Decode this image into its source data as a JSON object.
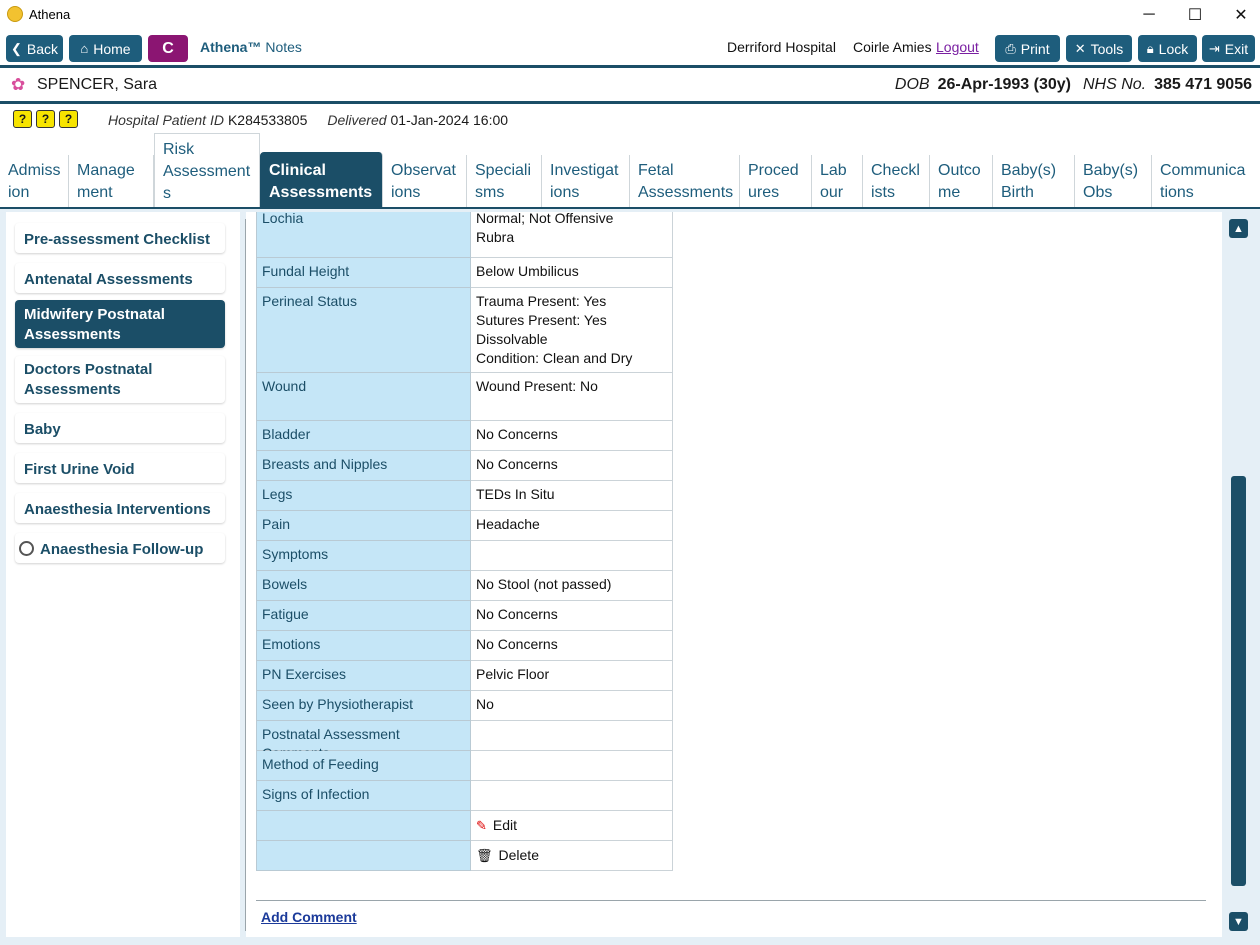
{
  "window": {
    "title": "Athena",
    "minimize": "─",
    "maximize": "☐",
    "close": "✕"
  },
  "toolbar": {
    "back": "Back",
    "home": "Home",
    "c_label": "C",
    "brand_name": "Athena™",
    "brand_sub": "Notes",
    "hospital": "Derriford Hospital",
    "user": "Coirle Amies",
    "logout": "Logout",
    "print": "Print",
    "tools": "Tools",
    "lock": "Lock",
    "exit": "Exit"
  },
  "patient": {
    "name": "SPENCER, Sara",
    "dob_label": "DOB",
    "dob": "26-Apr-1993 (30y)",
    "nhs_label": "NHS No.",
    "nhs": "385 471 9056",
    "hospital_id_label": "Hospital Patient ID",
    "hospital_id": "K284533805",
    "delivered_label": "Delivered",
    "delivered": "01-Jan-2024 16:00",
    "flags": [
      "?",
      "?",
      "?"
    ]
  },
  "tabs": [
    "Admiss ion",
    "Manage ment",
    "Risk Assessment s",
    "Clinical Assessments",
    "Observat ions",
    "Speciali sms",
    "Investigat ions",
    "Fetal Assessments",
    "Proced ures",
    "Lab our",
    "Checkl ists",
    "Outco me",
    "Baby(s) Birth",
    "Baby(s) Obs",
    "Communica tions"
  ],
  "sidebar": [
    "Pre-assessment Checklist",
    "Antenatal Assessments",
    "Midwifery Postnatal Assessments",
    "Doctors Postnatal Assessments",
    "Baby",
    "First Urine Void",
    "Anaesthesia Interventions",
    "Anaesthesia Follow-up"
  ],
  "fields": [
    {
      "label": "Lochia",
      "value": "Normal; Not Offensive\nRubra"
    },
    {
      "label": "Fundal Height",
      "value": "Below Umbilicus"
    },
    {
      "label": "Perineal Status",
      "value": "Trauma Present: Yes\nSutures Present: Yes\nDissolvable\nCondition: Clean and Dry"
    },
    {
      "label": "Wound",
      "value": "Wound Present: No"
    },
    {
      "label": "Bladder",
      "value": "No Concerns"
    },
    {
      "label": "Breasts and Nipples",
      "value": "No Concerns"
    },
    {
      "label": "Legs",
      "value": "TEDs In Situ"
    },
    {
      "label": "Pain",
      "value": "Headache"
    },
    {
      "label": "Symptoms",
      "value": ""
    },
    {
      "label": "Bowels",
      "value": "No Stool (not passed)"
    },
    {
      "label": "Fatigue",
      "value": "No Concerns"
    },
    {
      "label": "Emotions",
      "value": "No Concerns"
    },
    {
      "label": "PN Exercises",
      "value": "Pelvic Floor"
    },
    {
      "label": "Seen by Physiotherapist",
      "value": "No"
    },
    {
      "label": "Postnatal Assessment Comments",
      "value": ""
    },
    {
      "label": "Method of Feeding",
      "value": ""
    },
    {
      "label": "Signs of Infection",
      "value": ""
    }
  ],
  "actions": {
    "edit": "Edit",
    "delete": "Delete"
  },
  "add_comment": "Add Comment",
  "icons": {
    "back": "chevron-left-icon",
    "home": "home-icon",
    "print": "printer-icon",
    "tools": "tools-icon",
    "lock": "lock-icon",
    "exit": "exit-icon",
    "patient": "flower-icon",
    "edit": "pencil-icon",
    "delete": "trash-icon"
  },
  "colors": {
    "primary": "#1b4e67",
    "accent": "#8b1572",
    "label_bg": "#c5e6f7",
    "content_bg": "#e5eff6"
  }
}
